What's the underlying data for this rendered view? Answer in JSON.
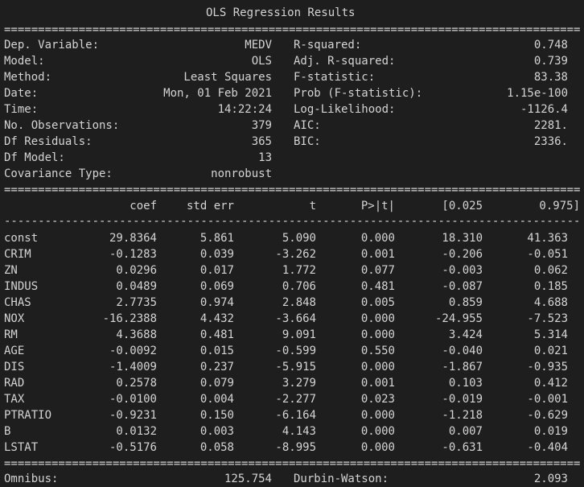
{
  "title": "OLS Regression Results",
  "rule_double": "================================================================================================================",
  "rule_single": "----------------------------------------------------------------------------------------------------------------",
  "summary": {
    "left": [
      {
        "label": "Dep. Variable:",
        "value": "MEDV"
      },
      {
        "label": "Model:",
        "value": "OLS"
      },
      {
        "label": "Method:",
        "value": "Least Squares"
      },
      {
        "label": "Date:",
        "value": "Mon, 01 Feb 2021"
      },
      {
        "label": "Time:",
        "value": "14:22:24"
      },
      {
        "label": "No. Observations:",
        "value": "379"
      },
      {
        "label": "Df Residuals:",
        "value": "365"
      },
      {
        "label": "Df Model:",
        "value": "13"
      },
      {
        "label": "Covariance Type:",
        "value": "nonrobust"
      }
    ],
    "right": [
      {
        "label": "R-squared:",
        "value": "0.748"
      },
      {
        "label": "Adj. R-squared:",
        "value": "0.739"
      },
      {
        "label": "F-statistic:",
        "value": "83.38"
      },
      {
        "label": "Prob (F-statistic):",
        "value": "1.15e-100"
      },
      {
        "label": "Log-Likelihood:",
        "value": "-1126.4"
      },
      {
        "label": "AIC:",
        "value": "2281."
      },
      {
        "label": "BIC:",
        "value": "2336."
      }
    ]
  },
  "coef_table": {
    "headers": [
      "coef",
      "std err",
      "t",
      "P>|t|",
      "[0.025",
      "0.975]"
    ],
    "rows": [
      {
        "name": "const",
        "values": [
          "29.8364",
          "5.861",
          "5.090",
          "0.000",
          "18.310",
          "41.363"
        ]
      },
      {
        "name": "CRIM",
        "values": [
          "-0.1283",
          "0.039",
          "-3.262",
          "0.001",
          "-0.206",
          "-0.051"
        ]
      },
      {
        "name": "ZN",
        "values": [
          "0.0296",
          "0.017",
          "1.772",
          "0.077",
          "-0.003",
          "0.062"
        ]
      },
      {
        "name": "INDUS",
        "values": [
          "0.0489",
          "0.069",
          "0.706",
          "0.481",
          "-0.087",
          "0.185"
        ]
      },
      {
        "name": "CHAS",
        "values": [
          "2.7735",
          "0.974",
          "2.848",
          "0.005",
          "0.859",
          "4.688"
        ]
      },
      {
        "name": "NOX",
        "values": [
          "-16.2388",
          "4.432",
          "-3.664",
          "0.000",
          "-24.955",
          "-7.523"
        ]
      },
      {
        "name": "RM",
        "values": [
          "4.3688",
          "0.481",
          "9.091",
          "0.000",
          "3.424",
          "5.314"
        ]
      },
      {
        "name": "AGE",
        "values": [
          "-0.0092",
          "0.015",
          "-0.599",
          "0.550",
          "-0.040",
          "0.021"
        ]
      },
      {
        "name": "DIS",
        "values": [
          "-1.4009",
          "0.237",
          "-5.915",
          "0.000",
          "-1.867",
          "-0.935"
        ]
      },
      {
        "name": "RAD",
        "values": [
          "0.2578",
          "0.079",
          "3.279",
          "0.001",
          "0.103",
          "0.412"
        ]
      },
      {
        "name": "TAX",
        "values": [
          "-0.0100",
          "0.004",
          "-2.277",
          "0.023",
          "-0.019",
          "-0.001"
        ]
      },
      {
        "name": "PTRATIO",
        "values": [
          "-0.9231",
          "0.150",
          "-6.164",
          "0.000",
          "-1.218",
          "-0.629"
        ]
      },
      {
        "name": "B",
        "values": [
          "0.0132",
          "0.003",
          "4.143",
          "0.000",
          "0.007",
          "0.019"
        ]
      },
      {
        "name": "LSTAT",
        "values": [
          "-0.5176",
          "0.058",
          "-8.995",
          "0.000",
          "-0.631",
          "-0.404"
        ]
      }
    ]
  },
  "footer": {
    "left_label": "Omnibus:",
    "left_value": "125.754",
    "right_label": "Durbin-Watson:",
    "right_value": "2.093"
  }
}
